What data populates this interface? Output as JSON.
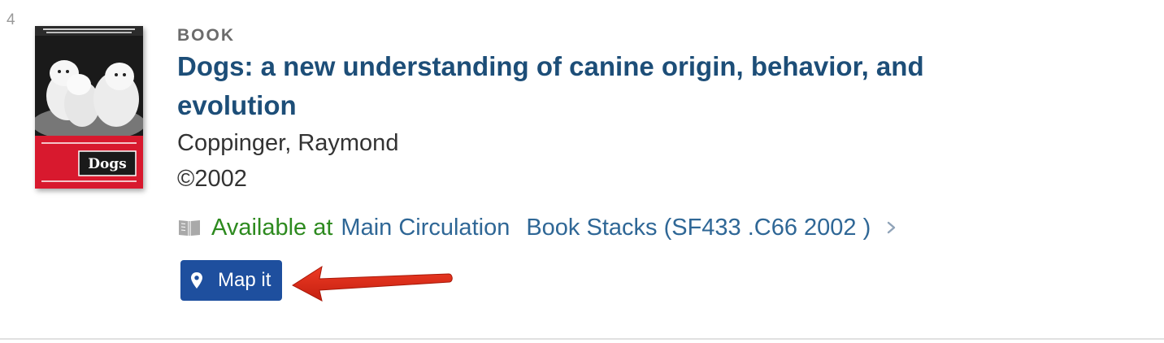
{
  "result": {
    "number": "4",
    "resource_type": "BOOK",
    "title": "Dogs: a new understanding of canine origin, behavior, and evolution",
    "author": "Coppinger, Raymond",
    "date": "©2002",
    "cover": {
      "label": "Dogs",
      "image_description": "book cover with white puppies over red band"
    },
    "availability": {
      "icon": "book-open-icon",
      "status": "Available at",
      "library": "Main Circulation",
      "location": "Book Stacks (SF433 .C66 2002 )"
    },
    "map_button_label": "Map it"
  },
  "colors": {
    "title": "#1d4e78",
    "status_available": "#2d8a1f",
    "location_link": "#2f6796",
    "map_button": "#1e4f9e",
    "annotation_arrow": "#d62a1a"
  }
}
